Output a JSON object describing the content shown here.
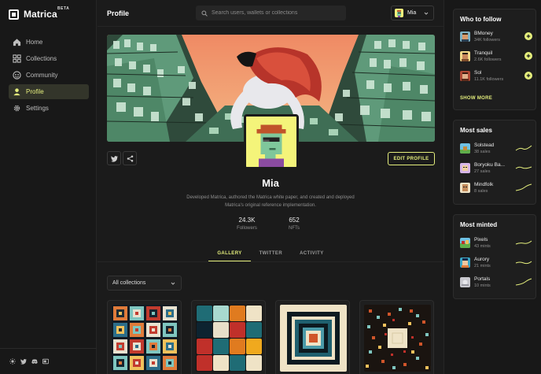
{
  "app": {
    "name": "Matrica",
    "beta": "BETA"
  },
  "sidebar": {
    "items": [
      {
        "label": "Home",
        "icon": "home-icon",
        "active": false
      },
      {
        "label": "Collections",
        "icon": "grid-icon",
        "active": false
      },
      {
        "label": "Community",
        "icon": "community-icon",
        "active": false
      },
      {
        "label": "Profile",
        "icon": "user-icon",
        "active": true
      },
      {
        "label": "Settings",
        "icon": "gear-icon",
        "active": false
      }
    ],
    "footer_icons": [
      "sun-icon",
      "twitter-icon",
      "discord-icon",
      "docs-icon"
    ]
  },
  "header": {
    "title": "Profile",
    "search_placeholder": "Search users, wallets or collections",
    "user": "Mia"
  },
  "profile": {
    "name": "Mia",
    "bio": "Developed Matrica, authored the Matrica white paper, and created and deployed Matrica's original reference implementation.",
    "edit_label": "EDIT PROFILE",
    "stats": [
      {
        "value": "24.3K",
        "label": "Followers"
      },
      {
        "value": "652",
        "label": "NFTs"
      }
    ],
    "tabs": [
      {
        "label": "GALLERY",
        "active": true
      },
      {
        "label": "TWITTER",
        "active": false
      },
      {
        "label": "ACTIVITY",
        "active": false
      }
    ],
    "collections_filter": "All collections"
  },
  "who_to_follow": {
    "title": "Who to follow",
    "items": [
      {
        "name": "BMoney",
        "sub": "34K followers"
      },
      {
        "name": "Tranquil",
        "sub": "2.6K followers"
      },
      {
        "name": "Sol",
        "sub": "11.1K followers"
      }
    ],
    "show_more": "SHOW MORE"
  },
  "most_sales": {
    "title": "Most sales",
    "items": [
      {
        "name": "Solstead",
        "sub": "38 sales"
      },
      {
        "name": "Boryoku Ba...",
        "sub": "27 sales"
      },
      {
        "name": "Mindfolk",
        "sub": "8 sales"
      }
    ]
  },
  "most_minted": {
    "title": "Most minted",
    "items": [
      {
        "name": "Pixels",
        "sub": "43 mints"
      },
      {
        "name": "Aurory",
        "sub": "21 mints"
      },
      {
        "name": "Portals",
        "sub": "10 mints"
      }
    ]
  },
  "colors": {
    "accent": "#e4ee7c",
    "background": "#1b1b1b",
    "panel": "#1e1e1e"
  }
}
